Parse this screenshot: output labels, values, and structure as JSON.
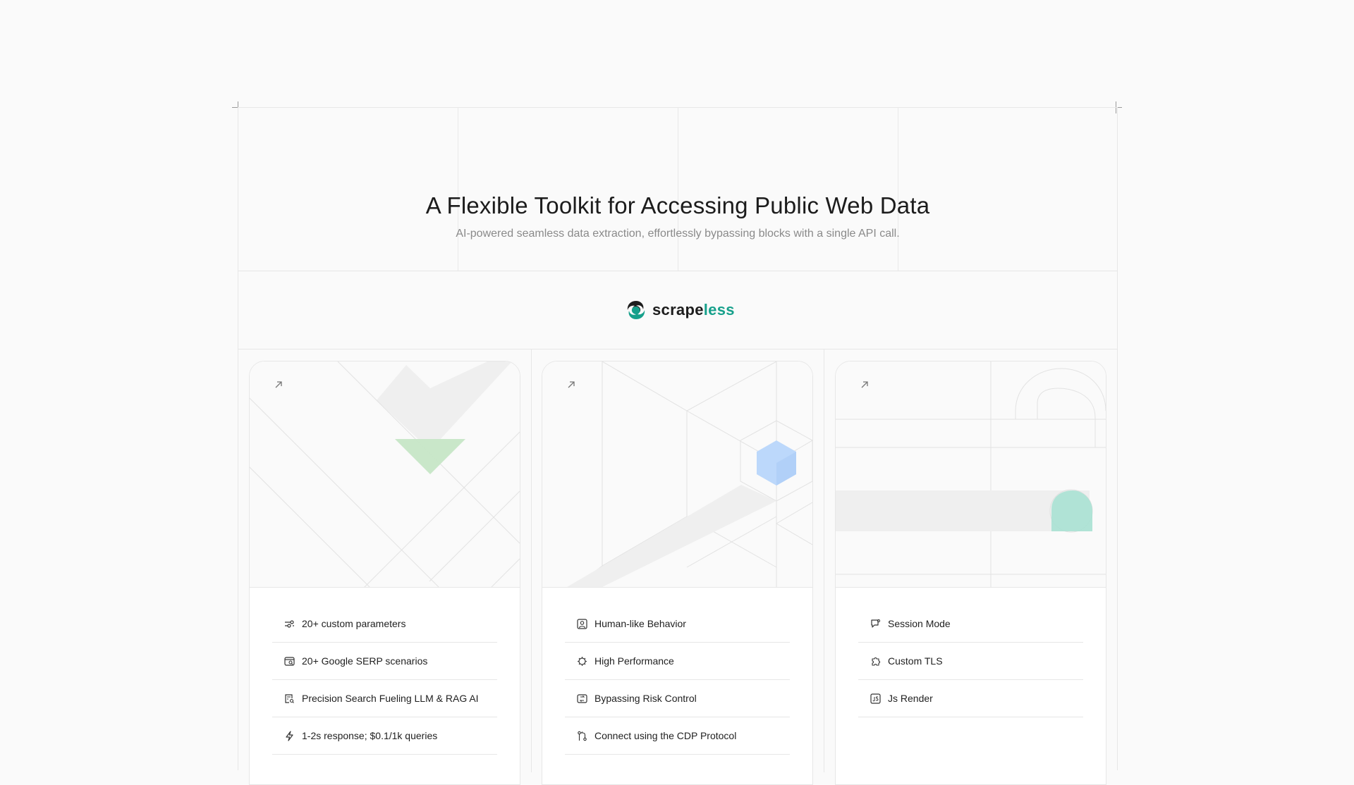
{
  "hero": {
    "title": "A Flexible Toolkit for Accessing Public Web Data",
    "subtitle": "AI-powered seamless data extraction, effortlessly bypassing blocks with a single API call."
  },
  "brand": {
    "name_main": "scrape",
    "name_accent": "less",
    "accent_color": "#16a08b"
  },
  "cards": [
    {
      "features": [
        {
          "icon": "sliders-icon",
          "label": "20+ custom parameters"
        },
        {
          "icon": "browser-search-icon",
          "label": "20+ Google SERP scenarios"
        },
        {
          "icon": "document-search-icon",
          "label": "Precision Search Fueling LLM & RAG AI"
        },
        {
          "icon": "lightning-icon",
          "label": "1-2s response; $0.1/1k queries"
        }
      ]
    },
    {
      "features": [
        {
          "icon": "user-square-icon",
          "label": "Human-like Behavior"
        },
        {
          "icon": "chip-icon",
          "label": "High Performance"
        },
        {
          "icon": "refresh-square-icon",
          "label": "Bypassing Risk Control"
        },
        {
          "icon": "git-pull-icon",
          "label": "Connect using the CDP Protocol"
        }
      ]
    },
    {
      "features": [
        {
          "icon": "chat-bubble-icon",
          "label": "Session Mode"
        },
        {
          "icon": "puzzle-icon",
          "label": "Custom TLS"
        },
        {
          "icon": "js-file-icon",
          "label": "Js Render"
        }
      ]
    }
  ]
}
